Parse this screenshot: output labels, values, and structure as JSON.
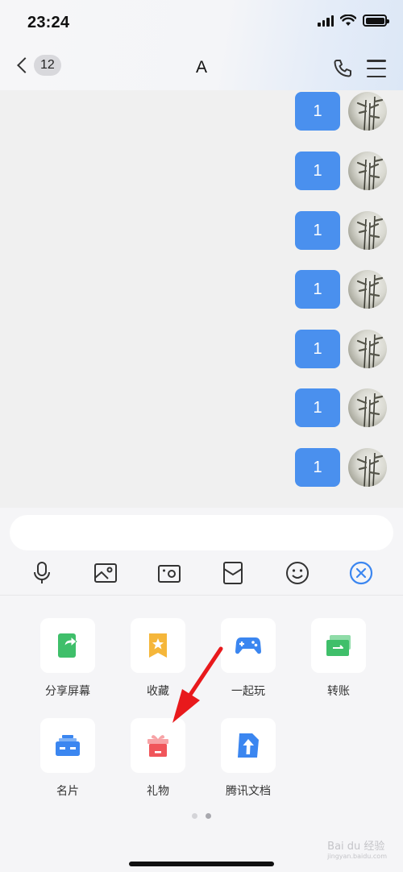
{
  "status_bar": {
    "time": "23:24"
  },
  "header": {
    "back_badge": "12",
    "title": "A"
  },
  "messages": [
    {
      "text": "1"
    },
    {
      "text": "1"
    },
    {
      "text": "1"
    },
    {
      "text": "1"
    },
    {
      "text": "1"
    },
    {
      "text": "1"
    },
    {
      "text": "1"
    }
  ],
  "input": {
    "placeholder": ""
  },
  "toolbar": {
    "icons": [
      "microphone-icon",
      "image-icon",
      "camera-icon",
      "red-envelope-icon",
      "emoji-icon",
      "close-icon"
    ]
  },
  "panel": {
    "items": [
      {
        "label": "分享屏幕",
        "icon": "share-screen-icon",
        "color": "#3fbf6a"
      },
      {
        "label": "收藏",
        "icon": "favorites-icon",
        "color": "#f5b63a"
      },
      {
        "label": "一起玩",
        "icon": "game-controller-icon",
        "color": "#3b86f0"
      },
      {
        "label": "转账",
        "icon": "transfer-icon",
        "color": "#3fbf6a"
      },
      {
        "label": "名片",
        "icon": "business-card-icon",
        "color": "#3b86f0"
      },
      {
        "label": "礼物",
        "icon": "gift-icon",
        "color": "#f0555a"
      },
      {
        "label": "腾讯文档",
        "icon": "tencent-docs-icon",
        "color": "#3b86f0"
      }
    ],
    "page_count": 2,
    "active_page": 2
  },
  "watermark": "Bai du 经验",
  "watermark_sub": "jingyan.baidu.com",
  "accent_color": "#4a90ee",
  "annotation_color": "#e8191c"
}
